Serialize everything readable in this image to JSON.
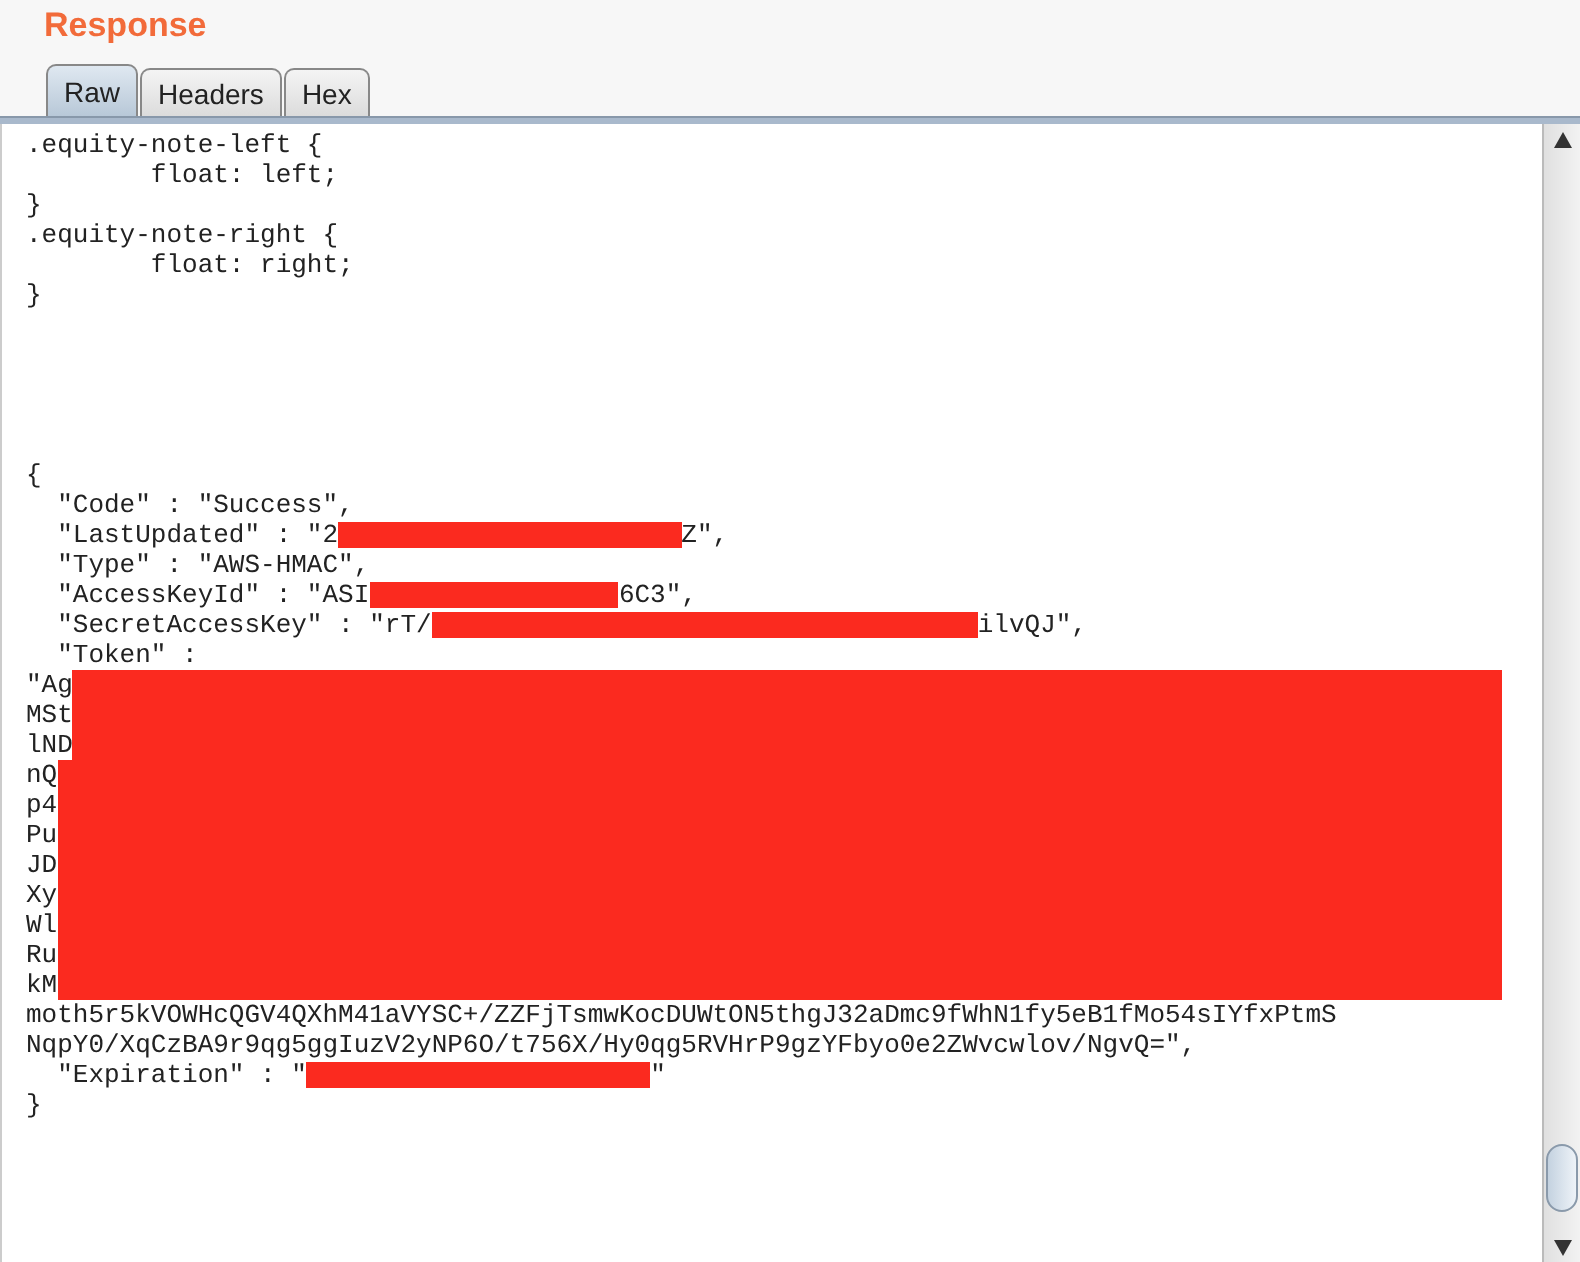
{
  "panel": {
    "title": "Response"
  },
  "tabs": [
    {
      "label": "Raw",
      "selected": true
    },
    {
      "label": "Headers",
      "selected": false
    },
    {
      "label": "Hex",
      "selected": false
    }
  ],
  "css_lines": [
    [
      {
        "kind": "text",
        "text": ".equity-note-left {"
      }
    ],
    [
      {
        "kind": "text",
        "text": "        float: left;"
      }
    ],
    [
      {
        "kind": "text",
        "text": "}"
      }
    ],
    [
      {
        "kind": "text",
        "text": ".equity-note-right {"
      }
    ],
    [
      {
        "kind": "text",
        "text": "        float: right;"
      }
    ],
    [
      {
        "kind": "text",
        "text": "}"
      }
    ]
  ],
  "json_lines": [
    [
      {
        "kind": "text",
        "text": "{"
      }
    ],
    [
      {
        "kind": "text",
        "text": "  \"Code\" : \"Success\","
      }
    ],
    [
      {
        "kind": "text",
        "text": "  \"LastUpdated\" : \"2"
      },
      {
        "kind": "midblot"
      },
      {
        "kind": "text",
        "text": "Z\","
      }
    ],
    [
      {
        "kind": "text",
        "text": "  \"Type\" : \"AWS-HMAC\","
      }
    ],
    [
      {
        "kind": "text",
        "text": "  \"AccessKeyId\" : \"ASI"
      },
      {
        "kind": "shortblot"
      },
      {
        "kind": "text",
        "text": "6C3\","
      }
    ],
    [
      {
        "kind": "text",
        "text": "  \"SecretAccessKey\" : \"rT/"
      },
      {
        "kind": "longblot"
      },
      {
        "kind": "text",
        "text": "ilvQJ\","
      }
    ],
    [
      {
        "kind": "text",
        "text": "  \"Token\" :"
      }
    ],
    [
      {
        "kind": "text",
        "text": "\"Ag"
      },
      {
        "kind": "fillblot"
      }
    ],
    [
      {
        "kind": "text",
        "text": "MSt"
      },
      {
        "kind": "fillblot"
      }
    ],
    [
      {
        "kind": "text",
        "text": "lND"
      },
      {
        "kind": "fillblot"
      }
    ],
    [
      {
        "kind": "text",
        "text": "nQ"
      },
      {
        "kind": "fillblot"
      }
    ],
    [
      {
        "kind": "text",
        "text": "p4"
      },
      {
        "kind": "fillblot"
      }
    ],
    [
      {
        "kind": "text",
        "text": "Pu"
      },
      {
        "kind": "fillblot"
      }
    ],
    [
      {
        "kind": "text",
        "text": "JD"
      },
      {
        "kind": "fillblot"
      }
    ],
    [
      {
        "kind": "text",
        "text": "Xy"
      },
      {
        "kind": "fillblot"
      }
    ],
    [
      {
        "kind": "text",
        "text": "Wl"
      },
      {
        "kind": "fillblot"
      }
    ],
    [
      {
        "kind": "text",
        "text": "Ru"
      },
      {
        "kind": "fillblot"
      }
    ],
    [
      {
        "kind": "text",
        "text": "kM"
      },
      {
        "kind": "fillblot"
      }
    ],
    [
      {
        "kind": "text",
        "text": "moth5r5kVOWHcQGV4QXhM41aVYSC+/ZZFjTsmwKocDUWtON5thgJ32aDmc9fWhN1fy5eB1fMo54sIYfxPtmS"
      }
    ],
    [
      {
        "kind": "text",
        "text": "NqpY0/XqCzBA9r9qg5ggIuzV2yNP6O/t756X/Hy0qg5RVHrP9gzYFbyo0e2ZWvcwlov/NgvQ=\","
      }
    ],
    [
      {
        "kind": "text",
        "text": "  \"Expiration\" : \""
      },
      {
        "kind": "midblot"
      },
      {
        "kind": "text",
        "text": "\""
      }
    ],
    [
      {
        "kind": "text",
        "text": "}"
      }
    ]
  ]
}
